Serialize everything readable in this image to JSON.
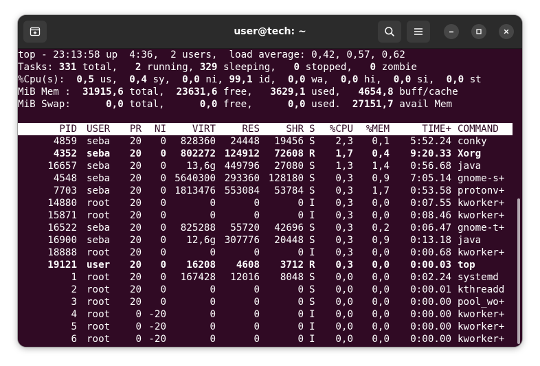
{
  "window": {
    "title": "user@tech: ~",
    "icons": [
      "new-tab-icon",
      "search-icon",
      "hamburger-menu-icon",
      "minimize-icon",
      "maximize-icon",
      "close-icon"
    ]
  },
  "summary": {
    "top_line": "top - 23:13:58 up  4:36,  2 users,  load average: 0,42, 0,57, 0,62",
    "tasks": [
      {
        "t": "Tasks: ",
        "b": false
      },
      {
        "t": "331",
        "b": true
      },
      {
        "t": " total,   ",
        "b": false
      },
      {
        "t": "2",
        "b": true
      },
      {
        "t": " running, ",
        "b": false
      },
      {
        "t": "329",
        "b": true
      },
      {
        "t": " sleeping,   ",
        "b": false
      },
      {
        "t": "0",
        "b": true
      },
      {
        "t": " stopped,   ",
        "b": false
      },
      {
        "t": "0",
        "b": true
      },
      {
        "t": " zombie",
        "b": false
      }
    ],
    "cpu": [
      {
        "t": "%Cpu(s):  ",
        "b": false
      },
      {
        "t": "0,5",
        "b": true
      },
      {
        "t": " us,  ",
        "b": false
      },
      {
        "t": "0,4",
        "b": true
      },
      {
        "t": " sy,  ",
        "b": false
      },
      {
        "t": "0,0",
        "b": true
      },
      {
        "t": " ni, ",
        "b": false
      },
      {
        "t": "99,1",
        "b": true
      },
      {
        "t": " id,  ",
        "b": false
      },
      {
        "t": "0,0",
        "b": true
      },
      {
        "t": " wa,  ",
        "b": false
      },
      {
        "t": "0,0",
        "b": true
      },
      {
        "t": " hi,  ",
        "b": false
      },
      {
        "t": "0,0",
        "b": true
      },
      {
        "t": " si,  ",
        "b": false
      },
      {
        "t": "0,0",
        "b": true
      },
      {
        "t": " st",
        "b": false
      }
    ],
    "mem": [
      {
        "t": "MiB Mem :  ",
        "b": false
      },
      {
        "t": "31915,6",
        "b": true
      },
      {
        "t": " total,  ",
        "b": false
      },
      {
        "t": "23631,6",
        "b": true
      },
      {
        "t": " free,   ",
        "b": false
      },
      {
        "t": "3629,1",
        "b": true
      },
      {
        "t": " used,   ",
        "b": false
      },
      {
        "t": "4654,8",
        "b": true
      },
      {
        "t": " buff/cache",
        "b": false
      }
    ],
    "swap": [
      {
        "t": "MiB Swap:      ",
        "b": false
      },
      {
        "t": "0,0",
        "b": true
      },
      {
        "t": " total,      ",
        "b": false
      },
      {
        "t": "0,0",
        "b": true
      },
      {
        "t": " free,      ",
        "b": false
      },
      {
        "t": "0,0",
        "b": true
      },
      {
        "t": " used.  ",
        "b": false
      },
      {
        "t": "27151,7",
        "b": true
      },
      {
        "t": " avail Mem",
        "b": false
      }
    ]
  },
  "process_table": {
    "columns": [
      "PID",
      "USER",
      "PR",
      "NI",
      "VIRT",
      "RES",
      "SHR",
      "S",
      "%CPU",
      "%MEM",
      "TIME+",
      "COMMAND"
    ],
    "rows": [
      {
        "bold": false,
        "cells": [
          "4859",
          "seba",
          "20",
          "0",
          "828360",
          "24448",
          "19456",
          "S",
          "2,3",
          "0,1",
          "5:52.24",
          "conky"
        ]
      },
      {
        "bold": true,
        "cells": [
          "4352",
          "seba",
          "20",
          "0",
          "802272",
          "124912",
          "72608",
          "R",
          "1,7",
          "0,4",
          "9:20.33",
          "Xorg"
        ]
      },
      {
        "bold": false,
        "cells": [
          "16657",
          "seba",
          "20",
          "0",
          "13,6g",
          "449796",
          "27080",
          "S",
          "1,3",
          "1,4",
          "0:56.68",
          "java"
        ]
      },
      {
        "bold": false,
        "cells": [
          "4548",
          "seba",
          "20",
          "0",
          "5640300",
          "293360",
          "128180",
          "S",
          "0,3",
          "0,9",
          "7:05.14",
          "gnome-s+"
        ]
      },
      {
        "bold": false,
        "cells": [
          "7703",
          "seba",
          "20",
          "0",
          "1813476",
          "553084",
          "53784",
          "S",
          "0,3",
          "1,7",
          "0:53.58",
          "protonv+"
        ]
      },
      {
        "bold": false,
        "cells": [
          "14880",
          "root",
          "20",
          "0",
          "0",
          "0",
          "0",
          "I",
          "0,3",
          "0,0",
          "0:07.55",
          "kworker+"
        ]
      },
      {
        "bold": false,
        "cells": [
          "15871",
          "root",
          "20",
          "0",
          "0",
          "0",
          "0",
          "I",
          "0,3",
          "0,0",
          "0:08.46",
          "kworker+"
        ]
      },
      {
        "bold": false,
        "cells": [
          "16522",
          "seba",
          "20",
          "0",
          "825288",
          "55720",
          "42696",
          "S",
          "0,3",
          "0,2",
          "0:06.47",
          "gnome-t+"
        ]
      },
      {
        "bold": false,
        "cells": [
          "16900",
          "seba",
          "20",
          "0",
          "12,6g",
          "307776",
          "20448",
          "S",
          "0,3",
          "0,9",
          "0:13.18",
          "java"
        ]
      },
      {
        "bold": false,
        "cells": [
          "18888",
          "root",
          "20",
          "0",
          "0",
          "0",
          "0",
          "I",
          "0,3",
          "0,0",
          "0:00.68",
          "kworker+"
        ]
      },
      {
        "bold": true,
        "cells": [
          "19121",
          "user",
          "20",
          "0",
          "16208",
          "4608",
          "3712",
          "R",
          "0,3",
          "0,0",
          "0:00.03",
          "top"
        ]
      },
      {
        "bold": false,
        "cells": [
          "1",
          "root",
          "20",
          "0",
          "167428",
          "12016",
          "8048",
          "S",
          "0,0",
          "0,0",
          "0:02.24",
          "systemd"
        ]
      },
      {
        "bold": false,
        "cells": [
          "2",
          "root",
          "20",
          "0",
          "0",
          "0",
          "0",
          "S",
          "0,0",
          "0,0",
          "0:00.01",
          "kthreadd"
        ]
      },
      {
        "bold": false,
        "cells": [
          "3",
          "root",
          "20",
          "0",
          "0",
          "0",
          "0",
          "S",
          "0,0",
          "0,0",
          "0:00.00",
          "pool_wo+"
        ]
      },
      {
        "bold": false,
        "cells": [
          "4",
          "root",
          "0",
          "-20",
          "0",
          "0",
          "0",
          "I",
          "0,0",
          "0,0",
          "0:00.00",
          "kworker+"
        ]
      },
      {
        "bold": false,
        "cells": [
          "5",
          "root",
          "0",
          "-20",
          "0",
          "0",
          "0",
          "I",
          "0,0",
          "0,0",
          "0:00.00",
          "kworker+"
        ]
      },
      {
        "bold": false,
        "cells": [
          "6",
          "root",
          "0",
          "-20",
          "0",
          "0",
          "0",
          "I",
          "0,0",
          "0,0",
          "0:00.00",
          "kworker+"
        ]
      }
    ]
  },
  "colors": {
    "terminal_bg": "#300a24",
    "titlebar_bg": "#2b2b2b",
    "text": "#ffffff"
  }
}
